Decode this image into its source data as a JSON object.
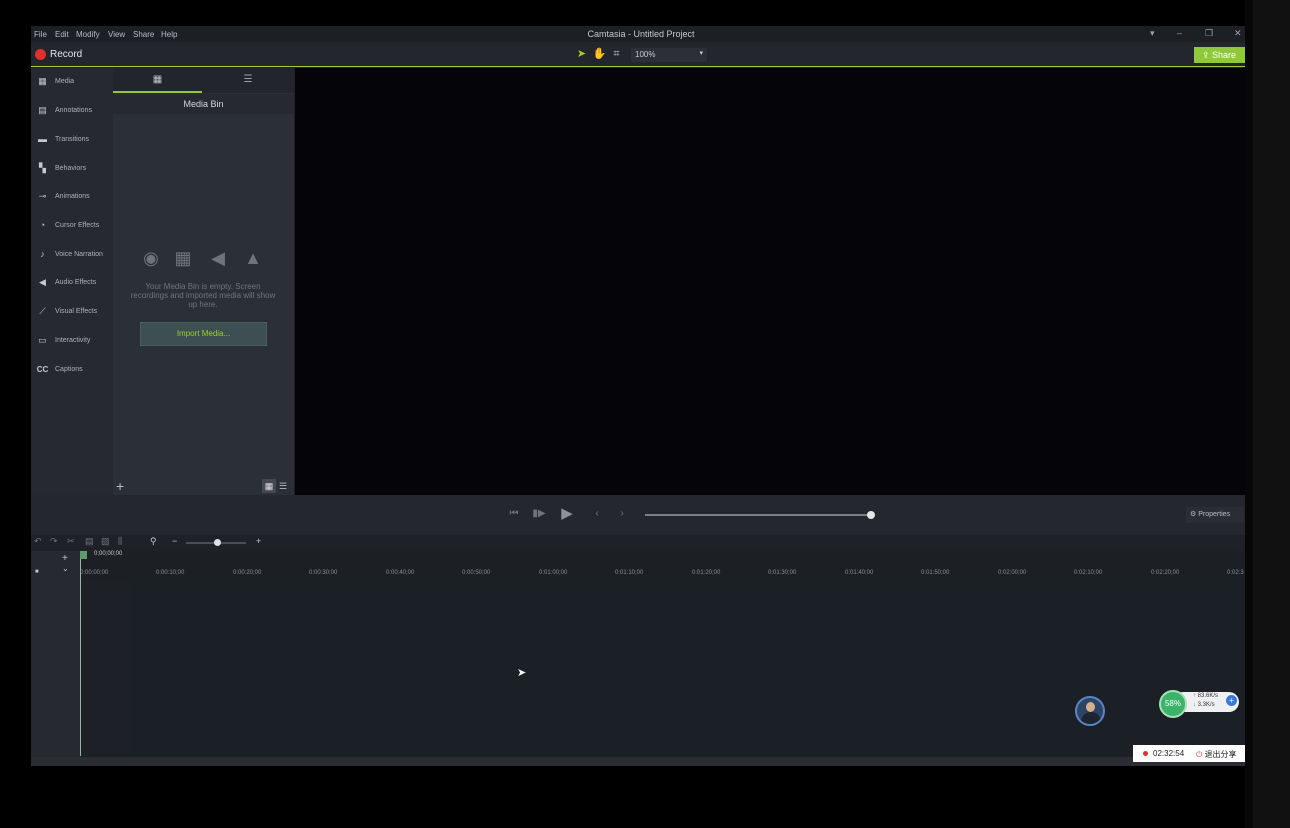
{
  "menubar": {
    "items": [
      "File",
      "Edit",
      "Modify",
      "View",
      "Share",
      "Help"
    ],
    "title": "Camtasia - Untitled Project"
  },
  "toolbar": {
    "record_label": "Record",
    "zoom_value": "100%",
    "share_label": "Share"
  },
  "sidebar": {
    "items": [
      {
        "label": "Media",
        "icon": "film-icon"
      },
      {
        "label": "Annotations",
        "icon": "annotation-icon"
      },
      {
        "label": "Transitions",
        "icon": "transition-icon"
      },
      {
        "label": "Behaviors",
        "icon": "behavior-icon"
      },
      {
        "label": "Animations",
        "icon": "animation-icon"
      },
      {
        "label": "Cursor Effects",
        "icon": "cursor-icon"
      },
      {
        "label": "Voice Narration",
        "icon": "microphone-icon"
      },
      {
        "label": "Audio Effects",
        "icon": "speaker-icon"
      },
      {
        "label": "Visual Effects",
        "icon": "wand-icon"
      },
      {
        "label": "Interactivity",
        "icon": "interactivity-icon"
      },
      {
        "label": "Captions",
        "icon": "captions-icon"
      }
    ]
  },
  "media_panel": {
    "title": "Media Bin",
    "empty_text": "Your Media Bin is empty. Screen recordings and imported media will show up here.",
    "import_label": "Import Media..."
  },
  "playback": {
    "properties_label": "Properties"
  },
  "timeline": {
    "playhead_time": "0;00;00;00",
    "ticks": [
      "0:00:00;00",
      "0:00:10;00",
      "0:00:20;00",
      "0:00:30;00",
      "0:00:40;00",
      "0:00:50;00",
      "0:01:00;00",
      "0:01:10;00",
      "0:01:20;00",
      "0:01:30;00",
      "0:01:40;00",
      "0:01:50;00",
      "0:02:00;00",
      "0:02:10;00",
      "0:02:20;00",
      "0:02:3"
    ]
  },
  "overlays": {
    "cpu": "58%",
    "net_up": "83.6K/s",
    "net_down": "3.3K/s",
    "rec_time": "02:32:54",
    "exit_share": "退出分享"
  },
  "colors": {
    "accent": "#8fc83a",
    "record": "#e0302a",
    "canvas": "#040409"
  }
}
